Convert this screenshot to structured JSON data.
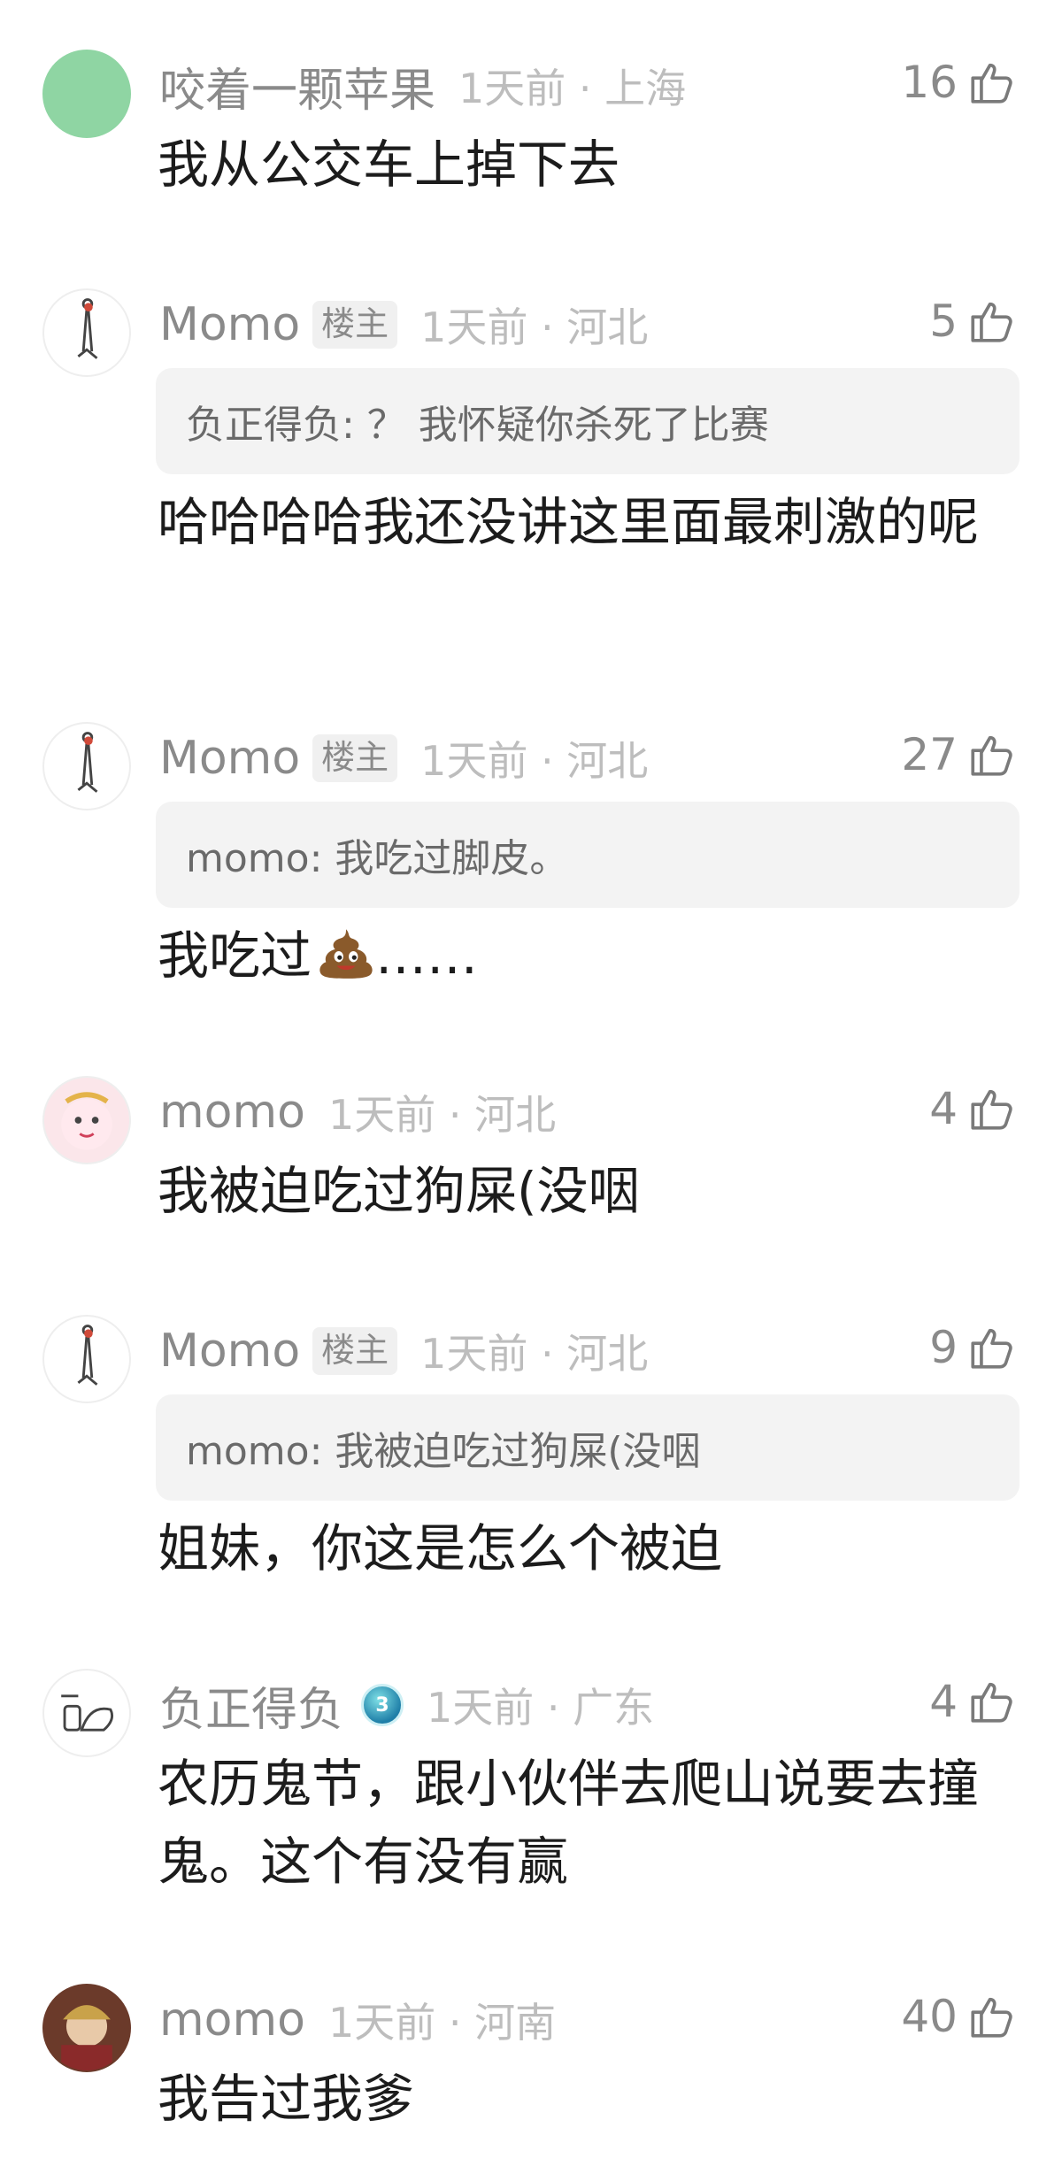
{
  "colors": {
    "username": "#8a8a8a",
    "meta": "#bdbdbd",
    "quote_bg": "#f3f3f3",
    "text": "#1c1c1c"
  },
  "comments": [
    {
      "username": "咬着一颗苹果",
      "meta": "1天前 · 上海",
      "likes": "16",
      "body": "我从公交车上掉下去"
    },
    {
      "username": "Momo",
      "badge": "楼主",
      "meta": "1天前 · 河北",
      "likes": "5",
      "quote": "负正得负: ？ 我怀疑你杀死了比赛",
      "body": "哈哈哈哈我还没讲这里面最刺激的呢"
    },
    {
      "username": "Momo",
      "badge": "楼主",
      "meta": "1天前 · 河北",
      "likes": "27",
      "quote": "momo: 我吃过脚皮。",
      "body_before": "我吃过",
      "emoji_icon": "poop-emoji-icon",
      "body_after": "……"
    },
    {
      "username": "momo",
      "meta": "1天前 · 河北",
      "likes": "4",
      "body": "我被迫吃过狗屎(没咽"
    },
    {
      "username": "Momo",
      "badge": "楼主",
      "meta": "1天前 · 河北",
      "likes": "9",
      "quote": "momo: 我被迫吃过狗屎(没咽",
      "body": "姐妹，你这是怎么个被迫"
    },
    {
      "username": "负正得负",
      "level": "3",
      "meta": "1天前 · 广东",
      "likes": "4",
      "body": "农历鬼节，跟小伙伴去爬山说要去撞鬼。这个有没有赢"
    },
    {
      "username": "momo",
      "meta": "1天前 · 河南",
      "likes": "40",
      "body": "我告过我爹"
    }
  ]
}
